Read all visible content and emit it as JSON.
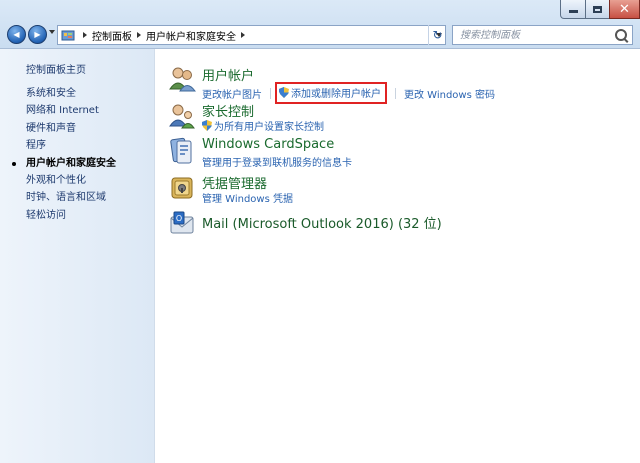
{
  "window": {
    "controls": {
      "minimize": "–",
      "maximize": "□",
      "close": "✕"
    }
  },
  "nav": {
    "back_glyph": "◀",
    "forward_glyph": "▶",
    "breadcrumb": [
      "控制面板",
      "用户帐户和家庭安全"
    ],
    "refresh_glyph": "↻"
  },
  "search": {
    "placeholder": "搜索控制面板"
  },
  "sidebar": {
    "home": "控制面板主页",
    "items": [
      {
        "label": "系统和安全",
        "current": false
      },
      {
        "label": "网络和 Internet",
        "current": false
      },
      {
        "label": "硬件和声音",
        "current": false
      },
      {
        "label": "程序",
        "current": false
      },
      {
        "label": "用户帐户和家庭安全",
        "current": true
      },
      {
        "label": "外观和个性化",
        "current": false
      },
      {
        "label": "时钟、语言和区域",
        "current": false
      },
      {
        "label": "轻松访问",
        "current": false
      }
    ]
  },
  "categories": {
    "user_accounts": {
      "title": "用户帐户",
      "link_change_picture": "更改帐户图片",
      "link_add_remove": "添加或删除用户帐户",
      "link_change_password": "更改 Windows 密码",
      "icon": "users-icon"
    },
    "parental": {
      "title": "家长控制",
      "link_setup": "为所有用户设置家长控制",
      "icon": "parental-controls-icon"
    },
    "cardspace": {
      "title": "Windows CardSpace",
      "link_manage": "管理用于登录到联机服务的信息卡",
      "icon": "cardspace-icon"
    },
    "credential": {
      "title": "凭据管理器",
      "link_manage": "管理 Windows 凭据",
      "icon": "credential-vault-icon"
    },
    "mail": {
      "title": "Mail (Microsoft Outlook 2016) (32 位)",
      "icon": "mail-icon"
    }
  },
  "colors": {
    "category_title": "#1a6a2e",
    "link": "#2a63b0",
    "highlight_border": "#e02323"
  }
}
